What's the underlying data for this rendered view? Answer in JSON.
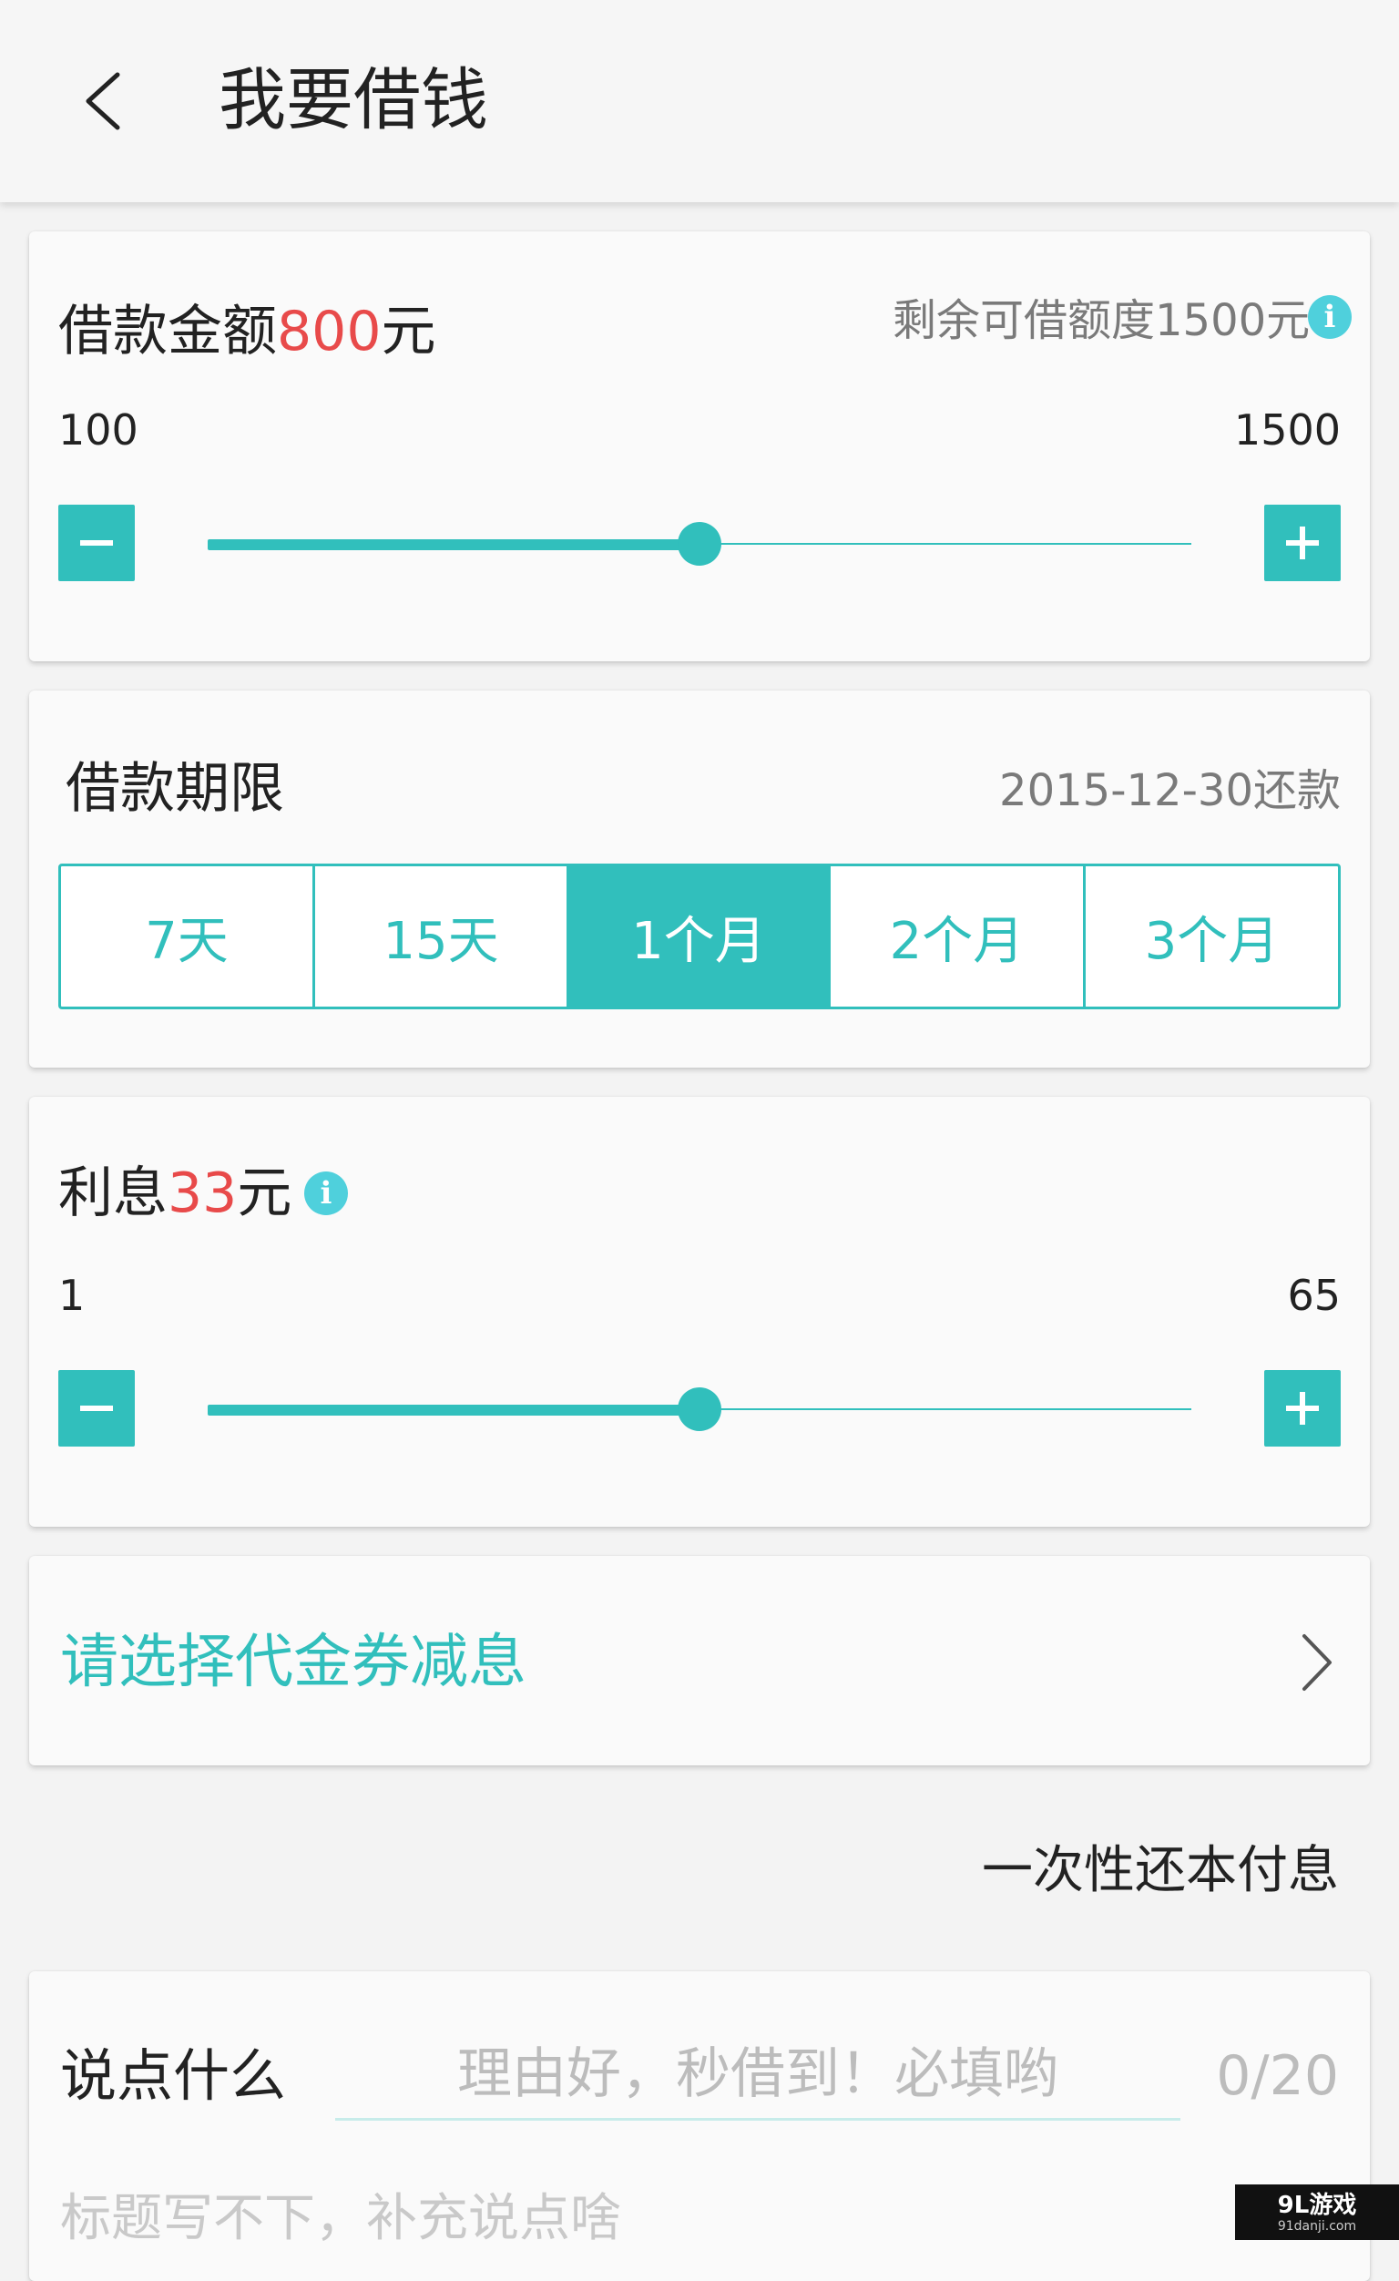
{
  "header": {
    "title": "我要借钱",
    "back_icon": "chevron-left-icon"
  },
  "loan_amount": {
    "label": "借款金额",
    "value": "800",
    "unit": "元",
    "remaining_text": "剩余可借额度1500元",
    "info_icon": "i",
    "min_label": "100",
    "max_label": "1500",
    "slider_fraction": 0.5,
    "minus_icon": "minus-icon",
    "plus_icon": "plus-icon"
  },
  "loan_term": {
    "label": "借款期限",
    "repay_date": "2015-12-30还款",
    "options": [
      {
        "label": "7天",
        "active": false
      },
      {
        "label": "15天",
        "active": false
      },
      {
        "label": "1个月",
        "active": true
      },
      {
        "label": "2个月",
        "active": false
      },
      {
        "label": "3个月",
        "active": false
      }
    ]
  },
  "interest": {
    "label": "利息",
    "value": "33",
    "unit": "元",
    "info_icon": "i",
    "min_label": "1",
    "max_label": "65",
    "slider_fraction": 0.5
  },
  "coupon": {
    "label": "请选择代金券减息",
    "chevron_icon": "chevron-right-icon"
  },
  "repayment_method": "一次性还本付息",
  "say_something": {
    "label": "说点什么",
    "placeholder": "理由好，秒借到！必填哟",
    "counter": "0/20",
    "extra_placeholder": "标题写不下，补充说点啥"
  },
  "watermark": {
    "main": "9L游戏",
    "sub": "91danji.com"
  },
  "colors": {
    "accent": "#31bfbc",
    "highlight_red": "#e84a4a",
    "info_blue": "#4fd0dc"
  }
}
